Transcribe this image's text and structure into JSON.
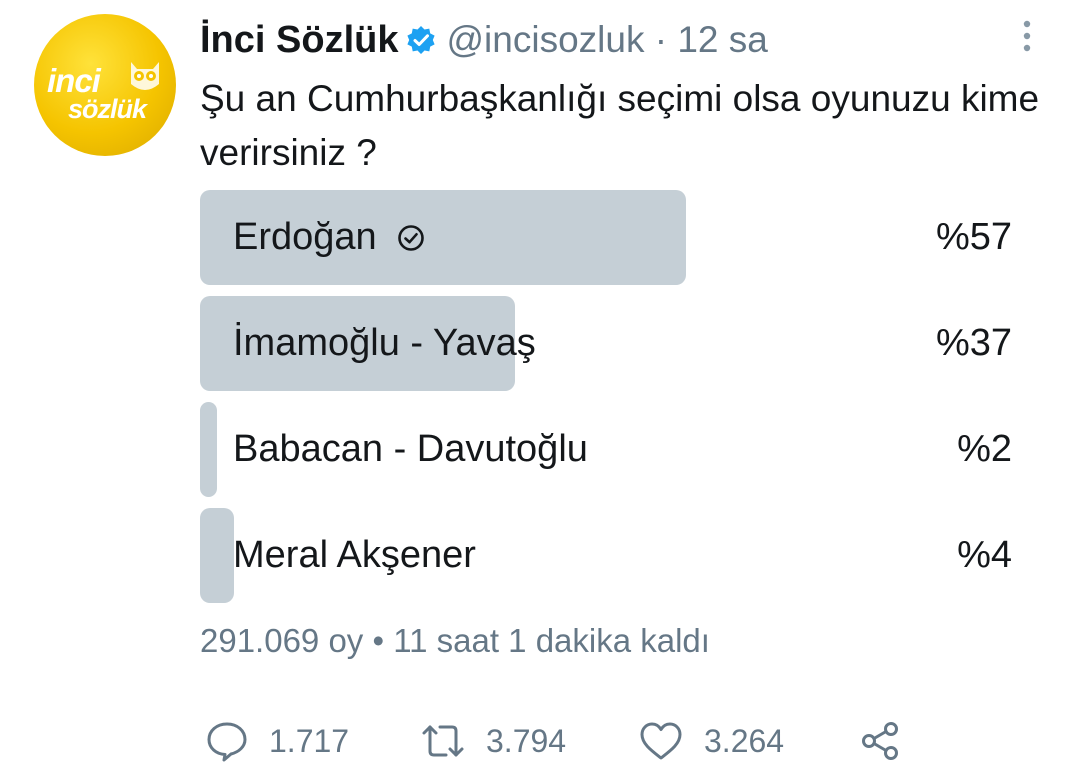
{
  "tweet": {
    "author_name": "İnci Sözlük",
    "handle_time": "@incisozluk · 12 sa",
    "text": "Şu an Cumhurbaşkanlığı seçimi olsa oyunuzu kime verirsiniz ?",
    "avatar": {
      "line1": "inci",
      "line2": "sözlük",
      "brand_color": "#f5c400"
    },
    "verified_icon": "verified-badge-icon",
    "accent_color": "#1da1f2"
  },
  "poll": {
    "options": [
      {
        "label": "Erdoğan",
        "percent_text": "%57",
        "fraction": 0.57,
        "selected": true
      },
      {
        "label": "İmamoğlu - Yavaş",
        "percent_text": "%37",
        "fraction": 0.37,
        "selected": false
      },
      {
        "label": "Babacan - Davutoğlu",
        "percent_text": "%2",
        "fraction": 0.02,
        "selected": false
      },
      {
        "label": "Meral Akşener",
        "percent_text": "%4",
        "fraction": 0.04,
        "selected": false
      }
    ],
    "meta": "291.069 oy • 11 saat 1 dakika kaldı",
    "bar_color": "#c5cfd6"
  },
  "actions": {
    "reply_count": "1.717",
    "retweet_count": "3.794",
    "like_count": "3.264",
    "icons": [
      "reply-icon",
      "retweet-icon",
      "like-icon",
      "share-icon"
    ]
  }
}
